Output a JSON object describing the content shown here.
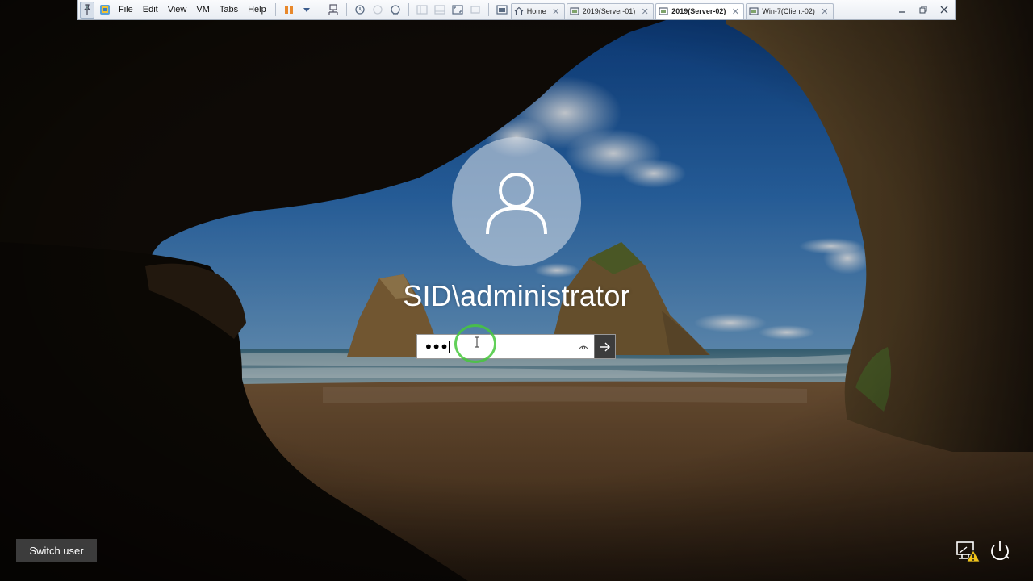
{
  "toolbar": {
    "menu": [
      "File",
      "Edit",
      "View",
      "VM",
      "Tabs",
      "Help"
    ],
    "tabs": [
      {
        "label": "Home",
        "icon": "home-icon",
        "active": false
      },
      {
        "label": "2019(Server-01)",
        "icon": "vm-icon",
        "active": false
      },
      {
        "label": "2019(Server-02)",
        "icon": "vm-icon",
        "active": true
      },
      {
        "label": "Win-7(Client-02)",
        "icon": "vm-icon",
        "active": false
      }
    ],
    "close_glyph": "✕",
    "window_buttons": [
      "minimize-icon",
      "restore-icon",
      "close-icon"
    ]
  },
  "login": {
    "username": "SID\\administrator",
    "password_masked": "•••",
    "reveal_icon": "eye-icon",
    "submit_icon": "arrow-right-icon"
  },
  "footer": {
    "switch_user_label": "Switch user",
    "network_icon": "network-warning-icon",
    "power_icon": "power-icon"
  },
  "colors": {
    "submit_bg": "#3c3c3c",
    "click_ring": "#46c83c",
    "switch_user_bg": "#464646"
  }
}
